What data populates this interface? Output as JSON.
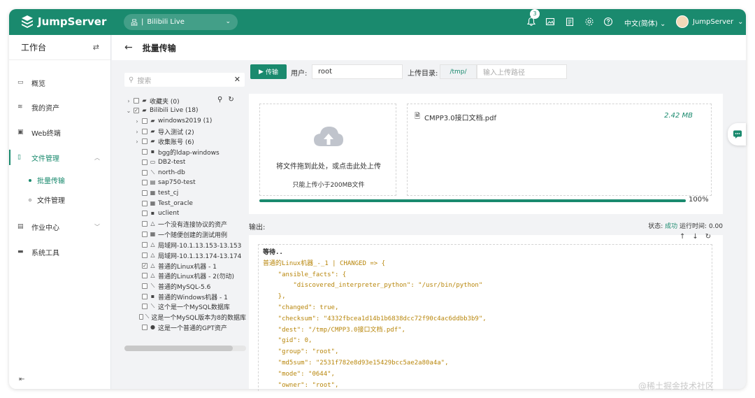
{
  "app": {
    "brand": "JumpServer"
  },
  "header": {
    "org": "Bilibili Live",
    "notification_count": "3",
    "language": "中文(简体)",
    "username": "JumpServer"
  },
  "sidebar": {
    "title": "工作台",
    "items": [
      {
        "label": "概览",
        "icon": "dashboard-icon"
      },
      {
        "label": "我的资产",
        "icon": "layers-icon"
      },
      {
        "label": "Web终端",
        "icon": "terminal-icon"
      },
      {
        "label": "文件管理",
        "icon": "file-icon"
      },
      {
        "label": "作业中心",
        "icon": "job-icon"
      },
      {
        "label": "系统工具",
        "icon": "toolbox-icon"
      }
    ],
    "sub_items": [
      {
        "label": "批量传输"
      },
      {
        "label": "文件管理"
      }
    ]
  },
  "page": {
    "title": "批量传输"
  },
  "tree": {
    "search_placeholder": "搜索",
    "nodes": [
      {
        "label": "收藏夹 (0)"
      },
      {
        "label": "Bilibili Live (18)"
      },
      {
        "label": "windows2019 (1)"
      },
      {
        "label": "导入测试 (2)"
      },
      {
        "label": "收集账号 (6)"
      },
      {
        "label": "bgg的ldap-windows"
      },
      {
        "label": "DB2-test"
      },
      {
        "label": "north-db"
      },
      {
        "label": "sap750-test"
      },
      {
        "label": "test_cj"
      },
      {
        "label": "Test_oracle"
      },
      {
        "label": "uclient"
      },
      {
        "label": "一个没有连接协议的资产"
      },
      {
        "label": "一个随便创建的测试用例"
      },
      {
        "label": "局域网-10.1.13.153-13.153"
      },
      {
        "label": "局域网-10.1.13.174-13.174"
      },
      {
        "label": "普通的Linux机器 - 1"
      },
      {
        "label": "普通的Linux机器 - 2(勿动)"
      },
      {
        "label": "普通的MySQL-5.6"
      },
      {
        "label": "普通的Windows机器 - 1"
      },
      {
        "label": "这个是一个MySQL数据库"
      },
      {
        "label": "这是一个MySQL版本为8的数据库"
      },
      {
        "label": "这是一个普通的GPT资产"
      }
    ]
  },
  "toolbar": {
    "upload_button": "传输",
    "user_label": "用户:",
    "user_value": "root",
    "dir_label": "上传目录:",
    "dir_prefix": "/tmp/",
    "dir_placeholder": "输入上传路径"
  },
  "upload": {
    "drop_text": "将文件拖到此处，或点击此处上传",
    "limit_text": "只能上传小于200MB文件",
    "file_name": "CMPP3.0接口文档.pdf",
    "file_size": "2.42 MB",
    "progress_text": "100%",
    "progress_fraction": 1.0
  },
  "output": {
    "label": "输出:",
    "status_label": "状态:",
    "status_value": "成功",
    "runtime_label": "运行时间:",
    "runtime_value": "0.00",
    "lines": [
      "等待..",
      "普通的Linux机器_-_1 | CHANGED => {",
      "    \"ansible_facts\": {",
      "        \"discovered_interpreter_python\": \"/usr/bin/python\"",
      "    },",
      "    \"changed\": true,",
      "    \"checksum\": \"4332fbcea1d14b1b6838dcc72f90c4ac6ddbb3b9\",",
      "    \"dest\": \"/tmp/CMPP3.0接口文档.pdf\",",
      "    \"gid\": 0,",
      "    \"group\": \"root\",",
      "    \"md5sum\": \"2531f782e8d93e15429bcc5ae2a80a4a\",",
      "    \"mode\": \"0644\",",
      "    \"owner\": \"root\","
    ]
  },
  "watermark": "@稀土掘金技术社区",
  "colors": {
    "brand": "#1a8a6e",
    "console_text": "#b8860b"
  }
}
